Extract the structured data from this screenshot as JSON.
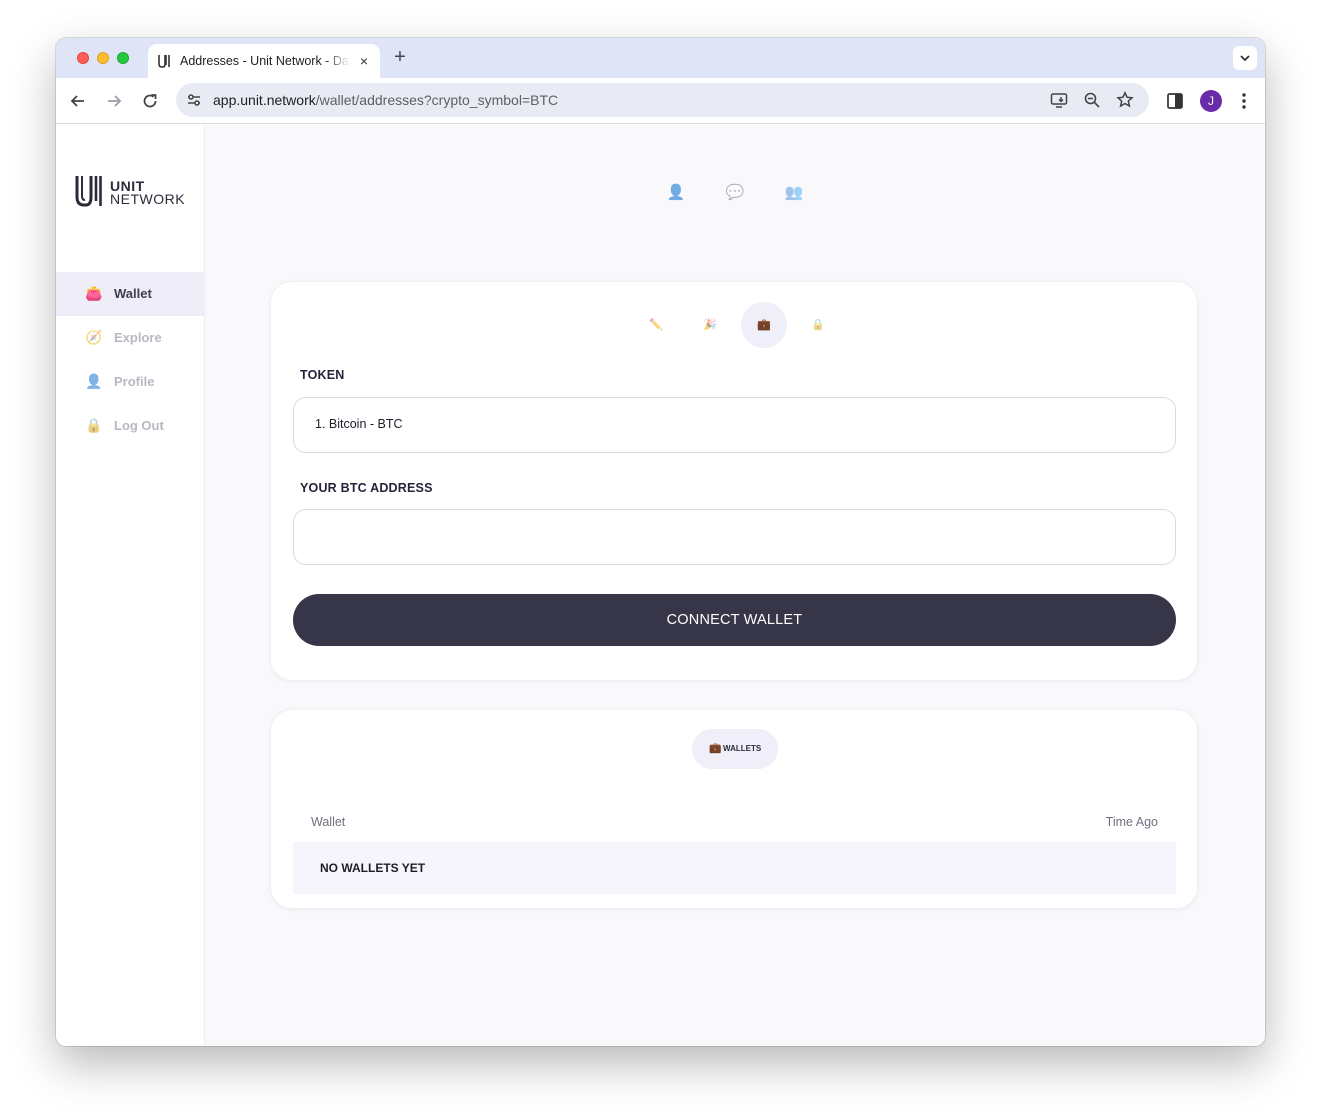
{
  "browser": {
    "tab_title": "Addresses - Unit Network - Dashboard",
    "tab_close": "×",
    "new_tab": "+",
    "url_host": "app.unit.network",
    "url_path": "/wallet/addresses?crypto_symbol=BTC",
    "avatar_letter": "J"
  },
  "logo": {
    "line1": "UNIT",
    "line2": "NETWORK"
  },
  "sidebar": {
    "items": [
      {
        "label": "Wallet",
        "icon": "wallet-icon",
        "glyph": "👛",
        "active": true
      },
      {
        "label": "Explore",
        "icon": "compass-icon",
        "glyph": "🧭",
        "active": false
      },
      {
        "label": "Profile",
        "icon": "person-icon",
        "glyph": "👤",
        "active": false
      },
      {
        "label": "Log Out",
        "icon": "lock-icon",
        "glyph": "🔒",
        "active": false
      }
    ]
  },
  "top_icons": [
    {
      "icon": "person-icon",
      "glyph": "👤"
    },
    {
      "icon": "speech-bubble-icon",
      "glyph": "💬"
    },
    {
      "icon": "people-icon",
      "glyph": "👥"
    }
  ],
  "steps": [
    {
      "icon": "pencil-icon",
      "glyph": "✏️"
    },
    {
      "icon": "party-popper-icon",
      "glyph": "🎉"
    },
    {
      "icon": "briefcase-icon",
      "glyph": "💼",
      "active": true
    },
    {
      "icon": "lock-icon",
      "glyph": "🔒"
    }
  ],
  "form": {
    "token_label": "TOKEN",
    "token_value": "1. Bitcoin - BTC",
    "address_label": "YOUR BTC ADDRESS",
    "address_value": "",
    "connect_button": "CONNECT WALLET"
  },
  "wallets": {
    "pill_label": "WALLETS",
    "pill_glyph": "💼",
    "columns": [
      "Wallet",
      "Time Ago"
    ],
    "empty_message": "NO WALLETS YET"
  }
}
